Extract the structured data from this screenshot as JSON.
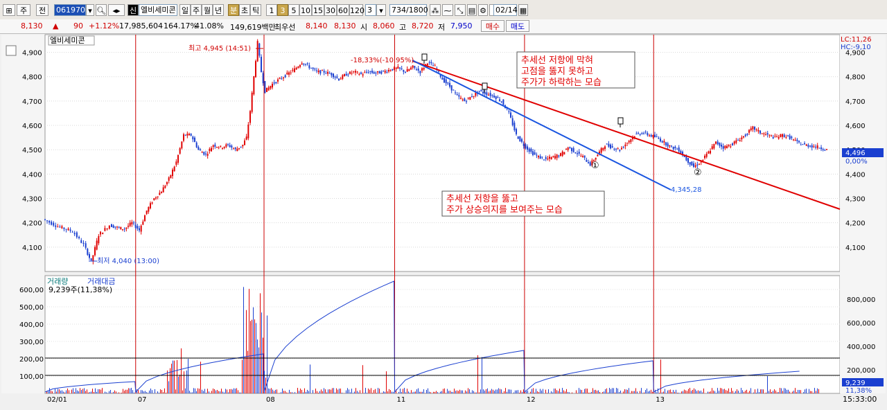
{
  "toolbar": {
    "code": "061970",
    "name_tag": "신",
    "stock_name": "엘비세미콘",
    "periods": [
      "일",
      "주",
      "월",
      "년",
      "분",
      "초",
      "틱"
    ],
    "interval_buttons": [
      "1",
      "3",
      "5",
      "10",
      "15",
      "30",
      "60",
      "120"
    ],
    "active_interval": "3",
    "interval_value": "3",
    "count": "734/1800",
    "date": "02/14",
    "left_buttons": [
      "주",
      "전"
    ]
  },
  "info": {
    "price": "8,130",
    "change": "90",
    "change_pct": "+1.12%",
    "volume": "17,985,604",
    "vol_ratio": "164.17%",
    "turnover": "41.08%",
    "amount": "149,619백만",
    "pref_label": "최우선",
    "bid": "8,140",
    "ask": "8,130",
    "open_label": "시",
    "open": "8,060",
    "high_label": "고",
    "high": "8,720",
    "low_label": "저",
    "low": "7,950",
    "buy_btn": "매수",
    "sell_btn": "매도"
  },
  "chart_data": {
    "type": "candlestick",
    "stock_label": "엘비세미콘",
    "price_axis": [
      4100,
      4200,
      4300,
      4400,
      4500,
      4600,
      4700,
      4800,
      4900
    ],
    "price_ylim": [
      4000,
      4950
    ],
    "volume_axis_left": [
      "100,00",
      "200,00",
      "300,00",
      "400,00",
      "500,00",
      "600,00"
    ],
    "volume_axis_right": [
      "200,000",
      "400,000",
      "600,000",
      "800,000"
    ],
    "date_labels": [
      "02/01",
      "07",
      "08",
      "11",
      "12",
      "13"
    ],
    "time_label": "15:33:00",
    "lc": "LC:11,26",
    "hc": "HC:-9,10",
    "last_price_box": "4,496",
    "last_pct": "0,00%",
    "high_annot": "최고 4,945 (14:51)",
    "low_annot": "최저 4,040 (13:00)",
    "pct_annot": "-18,33%(-10,95%)",
    "trend_end_label": "4,345,28",
    "volume_legend_1": "거래량",
    "volume_legend_2": "거래대금",
    "volume_value": "9,239주(11,38%)",
    "volume_box": "9,239",
    "volume_pct": "11,38%",
    "marker_1": "①",
    "marker_2": "②",
    "note_red": [
      "추세선 저항에 막혀",
      "고점을 뚫지 못하고",
      "주가가 하락하는 모습"
    ],
    "note_blue": [
      "추세선 저항을 뚫고",
      "주가 상승의지를 보여주는 모습"
    ],
    "price_path": [
      [
        0,
        4215
      ],
      [
        0.02,
        4185
      ],
      [
        0.04,
        4165
      ],
      [
        0.055,
        4110
      ],
      [
        0.065,
        4040
      ],
      [
        0.075,
        4150
      ],
      [
        0.09,
        4190
      ],
      [
        0.1,
        4180
      ],
      [
        0.11,
        4175
      ],
      [
        0.12,
        4200
      ],
      [
        0.13,
        4170
      ],
      [
        0.14,
        4250
      ],
      [
        0.15,
        4300
      ],
      [
        0.16,
        4330
      ],
      [
        0.17,
        4380
      ],
      [
        0.18,
        4450
      ],
      [
        0.19,
        4560
      ],
      [
        0.2,
        4560
      ],
      [
        0.21,
        4500
      ],
      [
        0.22,
        4480
      ],
      [
        0.23,
        4520
      ],
      [
        0.24,
        4510
      ],
      [
        0.25,
        4520
      ],
      [
        0.26,
        4500
      ],
      [
        0.27,
        4520
      ],
      [
        0.275,
        4550
      ],
      [
        0.28,
        4660
      ],
      [
        0.29,
        4940
      ],
      [
        0.295,
        4820
      ],
      [
        0.3,
        4740
      ],
      [
        0.31,
        4770
      ],
      [
        0.32,
        4790
      ],
      [
        0.33,
        4810
      ],
      [
        0.34,
        4830
      ],
      [
        0.35,
        4860
      ],
      [
        0.36,
        4840
      ],
      [
        0.37,
        4820
      ],
      [
        0.38,
        4820
      ],
      [
        0.39,
        4810
      ],
      [
        0.4,
        4790
      ],
      [
        0.41,
        4810
      ],
      [
        0.42,
        4820
      ],
      [
        0.43,
        4810
      ],
      [
        0.44,
        4820
      ],
      [
        0.45,
        4815
      ],
      [
        0.46,
        4820
      ],
      [
        0.47,
        4830
      ],
      [
        0.48,
        4835
      ],
      [
        0.49,
        4820
      ],
      [
        0.5,
        4840
      ],
      [
        0.51,
        4820
      ],
      [
        0.52,
        4860
      ],
      [
        0.53,
        4840
      ],
      [
        0.54,
        4790
      ],
      [
        0.55,
        4760
      ],
      [
        0.56,
        4720
      ],
      [
        0.57,
        4700
      ],
      [
        0.58,
        4720
      ],
      [
        0.59,
        4740
      ],
      [
        0.6,
        4730
      ],
      [
        0.61,
        4720
      ],
      [
        0.62,
        4700
      ],
      [
        0.63,
        4650
      ],
      [
        0.64,
        4560
      ],
      [
        0.65,
        4520
      ],
      [
        0.66,
        4490
      ],
      [
        0.67,
        4470
      ],
      [
        0.68,
        4460
      ],
      [
        0.69,
        4470
      ],
      [
        0.7,
        4480
      ],
      [
        0.71,
        4510
      ],
      [
        0.72,
        4490
      ],
      [
        0.73,
        4470
      ],
      [
        0.74,
        4440
      ],
      [
        0.75,
        4480
      ],
      [
        0.76,
        4520
      ],
      [
        0.77,
        4510
      ],
      [
        0.78,
        4500
      ],
      [
        0.79,
        4530
      ],
      [
        0.8,
        4560
      ],
      [
        0.81,
        4570
      ],
      [
        0.82,
        4560
      ],
      [
        0.83,
        4550
      ],
      [
        0.84,
        4530
      ],
      [
        0.85,
        4510
      ],
      [
        0.86,
        4500
      ],
      [
        0.87,
        4460
      ],
      [
        0.88,
        4430
      ],
      [
        0.89,
        4450
      ],
      [
        0.9,
        4490
      ],
      [
        0.91,
        4530
      ],
      [
        0.92,
        4510
      ],
      [
        0.93,
        4520
      ],
      [
        0.94,
        4540
      ],
      [
        0.95,
        4560
      ],
      [
        0.96,
        4590
      ],
      [
        0.97,
        4570
      ],
      [
        0.98,
        4560
      ],
      [
        0.99,
        4550
      ],
      [
        1.0,
        4560
      ],
      [
        1.01,
        4550
      ],
      [
        1.02,
        4530
      ],
      [
        1.03,
        4520
      ],
      [
        1.04,
        4515
      ],
      [
        1.05,
        4510
      ],
      [
        1.06,
        4500
      ]
    ]
  }
}
